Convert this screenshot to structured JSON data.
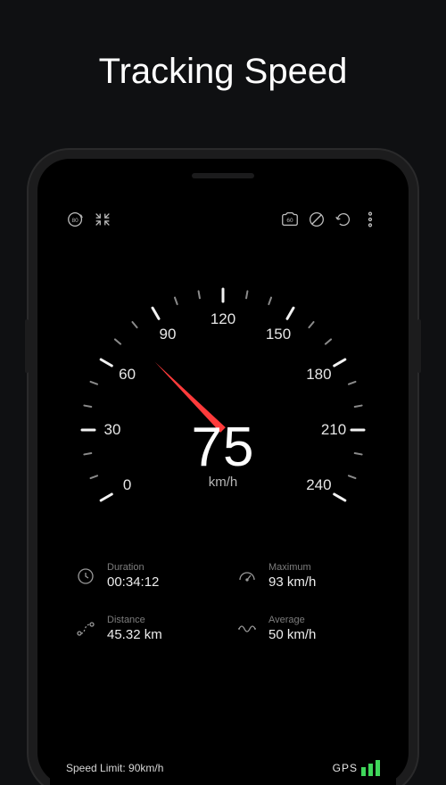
{
  "page_title": "Tracking Speed",
  "gauge": {
    "reading": "75",
    "unit": "km/h",
    "min": 0,
    "max": 240,
    "major_step": 30,
    "needle_color": "#ff3b3b"
  },
  "topbar": {
    "speed_limit_badge": "80",
    "camera_badge": "60"
  },
  "stats": {
    "duration": {
      "label": "Duration",
      "value": "00:34:12"
    },
    "maximum": {
      "label": "Maximum",
      "value": "93 km/h"
    },
    "distance": {
      "label": "Distance",
      "value": "45.32 km"
    },
    "average": {
      "label": "Average",
      "value": "50 km/h"
    }
  },
  "footer": {
    "speed_limit": "Speed Limit: 90km/h",
    "gps_label": "GPS"
  }
}
